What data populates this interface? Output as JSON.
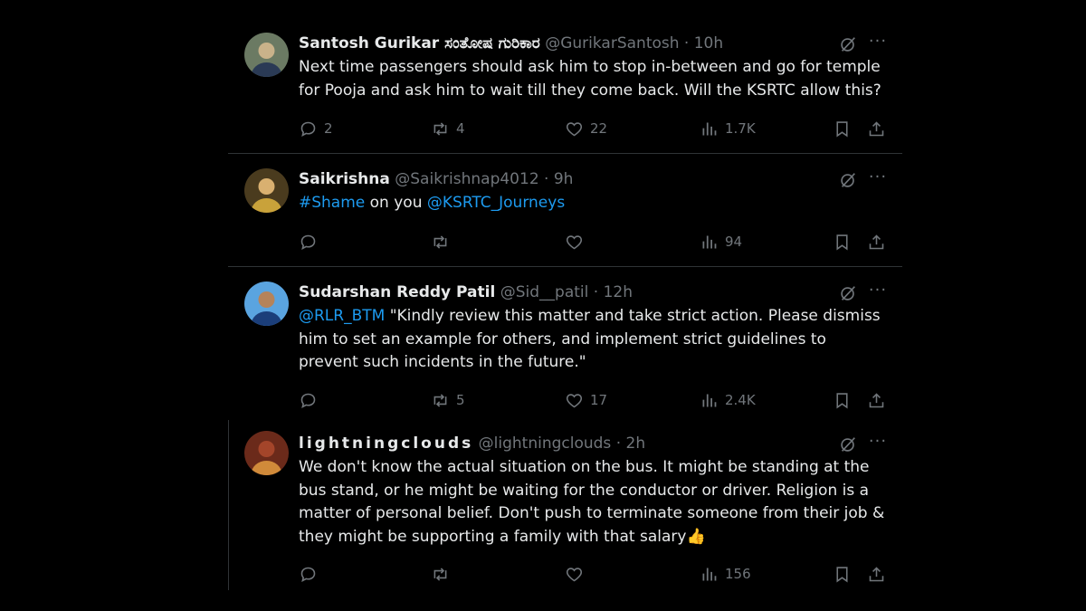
{
  "colors": {
    "background": "#000000",
    "text": "#e7e9ea",
    "muted": "#71767b",
    "link": "#1d9bf0",
    "divider": "#2f3336"
  },
  "tweets": [
    {
      "name": "Santosh Gurikar ಸಂತೋಷ ಗುರಿಕಾರ",
      "handle": "@GurikarSantosh",
      "dot": "·",
      "time": "10h",
      "avatar_icon": "user-avatar-photo",
      "text_segments": [
        {
          "text": "Next time passengers should ask him to stop in-between and go for temple for Pooja and ask him to wait till they come back. Will the KSRTC allow this?",
          "type": "text"
        }
      ],
      "replies": "2",
      "reposts": "4",
      "likes": "22",
      "views": "1.7K"
    },
    {
      "name": "Saikrishna",
      "handle": "@Saikrishnap4012",
      "dot": "·",
      "time": "9h",
      "avatar_icon": "user-avatar-photo",
      "text_segments": [
        {
          "text": "#Shame",
          "type": "link"
        },
        {
          "text": " on you ",
          "type": "text"
        },
        {
          "text": "@KSRTC_Journeys",
          "type": "link"
        }
      ],
      "replies": "",
      "reposts": "",
      "likes": "",
      "views": "94"
    },
    {
      "name": "Sudarshan Reddy Patil",
      "handle": "@Sid__patil",
      "dot": "·",
      "time": "12h",
      "avatar_icon": "user-avatar-photo",
      "text_segments": [
        {
          "text": "@RLR_BTM",
          "type": "link"
        },
        {
          "text": " \"Kindly review this matter and take strict action. Please dismiss him to set an example for others, and implement strict guidelines to prevent such incidents in the future.\"",
          "type": "text"
        }
      ],
      "replies": "",
      "reposts": "5",
      "likes": "17",
      "views": "2.4K"
    },
    {
      "name": "lightningclouds",
      "handle": "@lightningclouds",
      "dot": "·",
      "time": "2h",
      "avatar_icon": "user-avatar-photo",
      "text_segments": [
        {
          "text": "We don't know the actual situation on the bus. It might be standing at the bus stand, or he might be waiting for the conductor or driver. Religion is a matter of personal belief. Don't push to terminate someone from their job & they might be supporting a family with that salary👍",
          "type": "text"
        }
      ],
      "replies": "",
      "reposts": "",
      "likes": "",
      "views": "156"
    }
  ],
  "icons": {
    "grok": "grok-icon",
    "more": "more-options-icon",
    "reply": "reply-icon",
    "repost": "repost-icon",
    "like": "heart-icon",
    "views": "views-icon",
    "bookmark": "bookmark-icon",
    "share": "share-icon"
  },
  "more_glyph": "···"
}
